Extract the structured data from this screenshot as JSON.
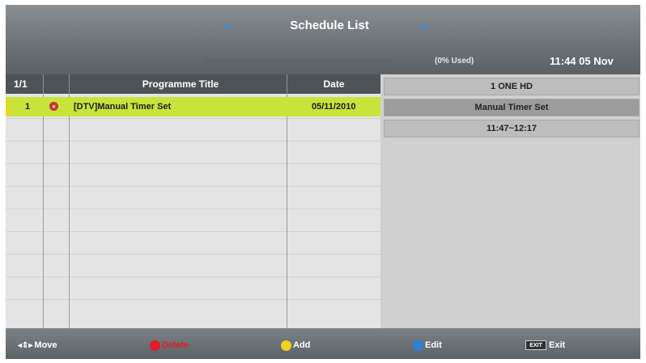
{
  "header": {
    "title": "Schedule List",
    "storage_text": "(0% Used)",
    "clock": "11:44 05 Nov"
  },
  "table": {
    "page": "1/1",
    "col_title": "Programme Title",
    "col_date": "Date",
    "rows": [
      {
        "num": "1",
        "rec_icon": "record-icon",
        "title": "[DTV]Manual Timer Set",
        "date": "05/11/2010"
      }
    ]
  },
  "details": {
    "channel": "1 ONE HD",
    "event": "Manual Timer Set",
    "time": "11:47~12:17"
  },
  "footer": {
    "move": "Move",
    "delete": "Delete",
    "add": "Add",
    "edit": "Edit",
    "exit": "Exit",
    "exit_key": "EXIT"
  },
  "colors": {
    "highlight": "#c8e43a",
    "red_key": "#e21b2a",
    "yellow_key": "#f2d21a",
    "blue_key": "#2f7fd6"
  }
}
